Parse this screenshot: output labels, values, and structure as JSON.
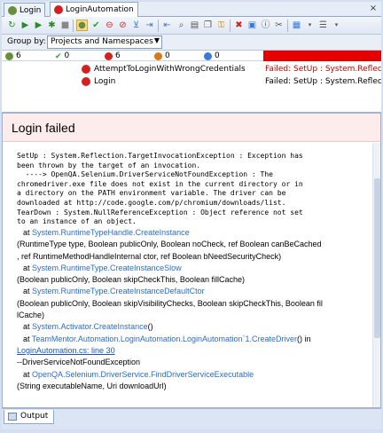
{
  "tabs": [
    {
      "label": "Login",
      "icon": "test-status-icon",
      "active": false
    },
    {
      "label": "LoginAutomation",
      "icon": "failed-status-icon",
      "active": true
    }
  ],
  "toolbar": {
    "icons": [
      "run-all-icon",
      "run-icon",
      "run-selected-icon",
      "debug-icon",
      "stop-icon",
      "tree-icon",
      "filter-failed-icon",
      "filter-ignored-icon",
      "filter-icon",
      "export-icon",
      "collapse-icon",
      "find-icon",
      "open-icon",
      "copy-icon",
      "lock-icon",
      "delete-icon",
      "unit-icon",
      "info-icon",
      "cut-icon",
      "window-icon",
      "settings-icon"
    ]
  },
  "group_by": {
    "label": "Group by:",
    "value": "Projects and Namespaces"
  },
  "stats": [
    {
      "icon": "total-tests-icon",
      "value": "6",
      "color": "#6a8f3a"
    },
    {
      "icon": "passed-tests-icon",
      "value": "0",
      "color": "#2e9e3e"
    },
    {
      "icon": "failed-tests-icon",
      "value": "6",
      "color": "#d42020"
    },
    {
      "icon": "ignored-tests-icon",
      "value": "0",
      "color": "#d67a1a"
    },
    {
      "icon": "inconclusive-tests-icon",
      "value": "0",
      "color": "#3a7bd5"
    }
  ],
  "results": [
    {
      "name": "AttemptToLoginWithWrongCredentials",
      "icon": "failed-warning-icon",
      "status": "Failed: SetUp : System.Reflection.TargetInvocationException"
    },
    {
      "name": "Login",
      "icon": "failed-icon",
      "status": "Failed: SetUp : System.Reflection.TargetInvocationException"
    }
  ],
  "details": {
    "title": "Login failed",
    "message_lines": [
      "SetUp : System.Reflection.TargetInvocationException : Exception has",
      "been thrown by the target of an invocation.",
      "  ----> OpenQA.Selenium.DriverServiceNotFoundException : The",
      "chromedriver.exe file does not exist in the current directory or in",
      "a directory on the PATH environment variable. The driver can be",
      "downloaded at http://code.google.com/p/chromium/downloads/list.",
      "TearDown : System.NullReferenceException : Object reference not set",
      "to an instance of an object."
    ],
    "stack": {
      "l1_prefix": "at ",
      "l1_type": "System.RuntimeTypeHandle.",
      "l1_method": "CreateInstance",
      "l2": "(RuntimeType type, Boolean publicOnly, Boolean noCheck, ref Boolean canBeCached",
      "l3": ", ref RuntimeMethodHandleInternal ctor, ref Boolean bNeedSecurityCheck)",
      "l4_prefix": "at ",
      "l4_type": "System.RuntimeType.",
      "l4_method": "CreateInstanceSlow",
      "l5": "(Boolean publicOnly, Boolean skipCheckThis, Boolean fillCache)",
      "l6_prefix": "at ",
      "l6_type": "System.RuntimeType.",
      "l6_method": "CreateInstanceDefaultCtor",
      "l7": "(Boolean publicOnly, Boolean skipVisibilityChecks, Boolean skipCheckThis, Boolean fil",
      "l8": "lCache)",
      "l9_prefix": "at ",
      "l9_type": "System.Activator.",
      "l9_method": "CreateInstance",
      "l9_suffix": "()",
      "l10_prefix": "at ",
      "l10_type": "TeamMentor.Automation.LoginAutomation.LoginAutomation`1.",
      "l10_method": "CreateDriver",
      "l10_suffix": "() in",
      "l11_link": "LoginAutomation.cs: line 30",
      "l12": "--DriverServiceNotFoundException",
      "l13_prefix": "at ",
      "l13_type": "OpenQA.Selenium.DriverService.",
      "l13_method": "FindDriverServiceExecutable",
      "l14": "(String executableName, Uri downloadUrl)"
    }
  },
  "output_tab": {
    "label": "Output"
  },
  "colors": {
    "failed_bar": "#e60000",
    "detail_header": "#fdecec",
    "link": "#1a56b8"
  }
}
